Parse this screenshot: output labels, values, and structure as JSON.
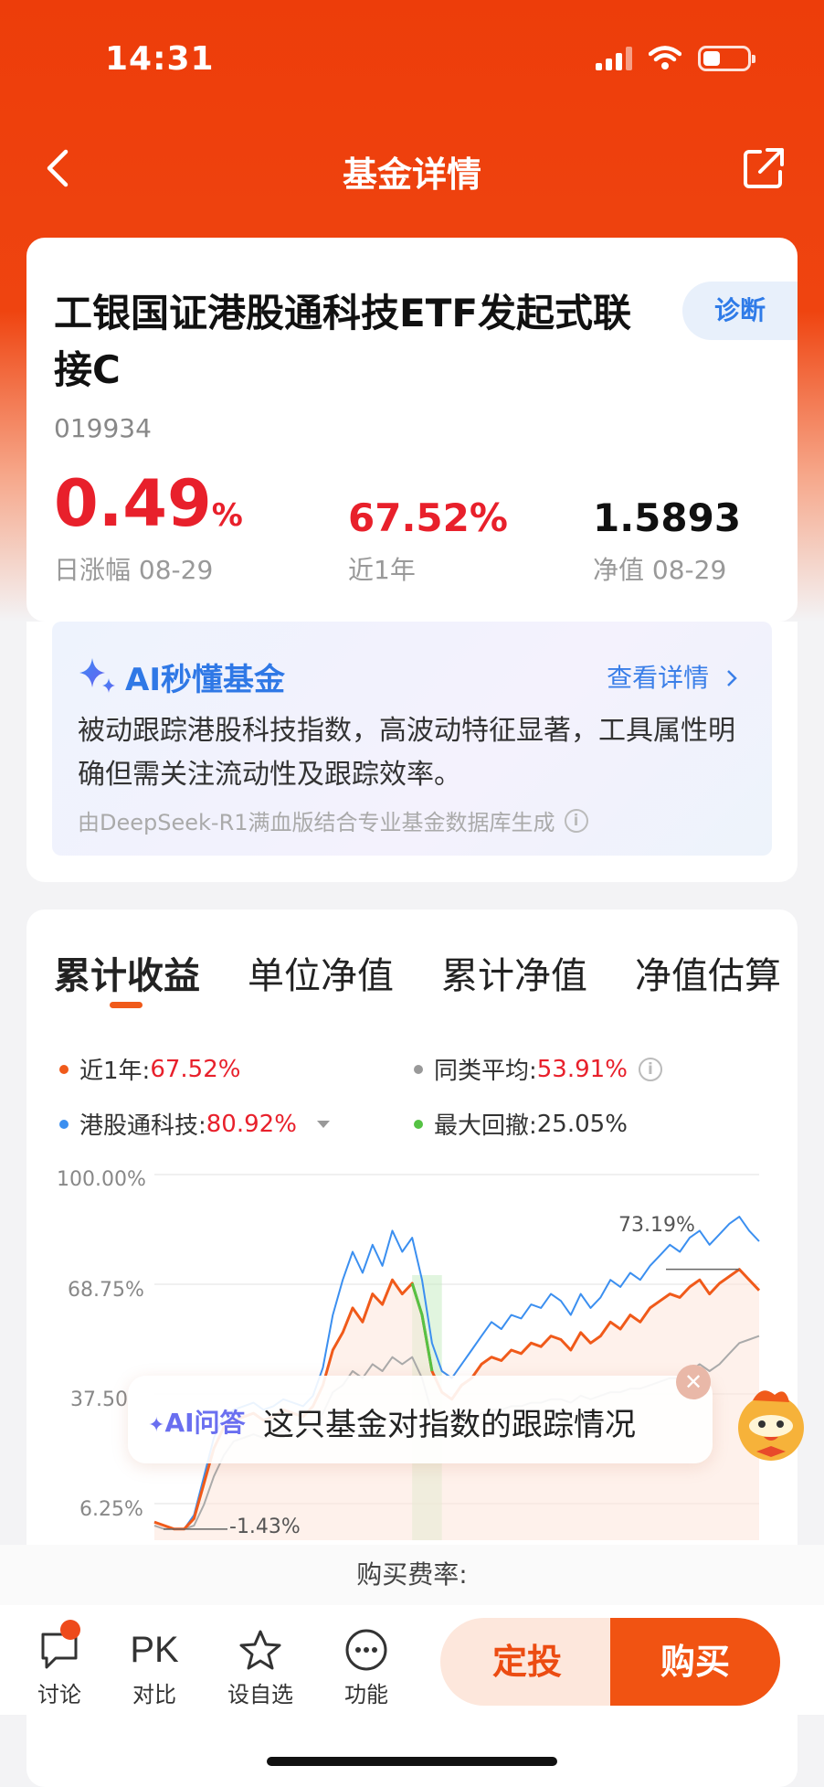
{
  "status_bar": {
    "time": "14:31"
  },
  "nav": {
    "title": "基金详情"
  },
  "fund": {
    "name": "工银国证港股通科技ETF发起式联接C",
    "code": "019934",
    "diagnose_label": "诊断",
    "daily_change_value": "0.49",
    "daily_change_unit": "%",
    "daily_change_label": "日涨幅 08-29",
    "year_return": "67.52%",
    "year_return_label": "近1年",
    "nav_value": "1.5893",
    "nav_label": "净值 08-29"
  },
  "ai_card": {
    "title": "AI秒懂基金",
    "more_label": "查看详情",
    "summary": "被动跟踪港股科技指数，高波动特征显著，工具属性明确但需关注流动性及跟踪效率。",
    "footnote": "由DeepSeek-R1满血版结合专业基金数据库生成"
  },
  "tabs": [
    "累计收益",
    "单位净值",
    "累计净值",
    "净值估算"
  ],
  "legend": {
    "year": {
      "label": "近1年:",
      "value": "67.52%",
      "color": "#f05a1a"
    },
    "peer_avg": {
      "label": "同类平均:",
      "value": "53.91%",
      "color": "#999999"
    },
    "index": {
      "label": "港股通科技:",
      "value": "80.92%",
      "color": "#3b8ff0"
    },
    "max_drawdown": {
      "label": "最大回撤:",
      "value": "25.05%",
      "color": "#55c244"
    }
  },
  "chart_data": {
    "type": "line",
    "y_ticks": [
      "100.00%",
      "68.75%",
      "37.50",
      "6.25%"
    ],
    "ylim": [
      -10,
      100
    ],
    "annotations": [
      "73.19%",
      "-1.43%"
    ],
    "series": [
      {
        "name": "近1年",
        "color": "#f05a1a",
        "values": [
          1,
          0,
          -1,
          -1,
          2,
          12,
          22,
          28,
          30,
          31,
          32,
          30,
          31,
          33,
          32,
          31,
          34,
          40,
          50,
          55,
          62,
          58,
          66,
          63,
          70,
          66,
          69,
          60,
          44,
          38,
          36,
          40,
          42,
          46,
          48,
          47,
          50,
          49,
          52,
          51,
          54,
          53,
          50,
          55,
          52,
          54,
          58,
          56,
          60,
          58,
          62,
          64,
          66,
          65,
          68,
          70,
          66,
          69,
          71,
          73,
          70,
          67
        ]
      },
      {
        "name": "港股通科技",
        "color": "#3b8ff0",
        "values": [
          1,
          0,
          -1,
          -1,
          3,
          14,
          25,
          31,
          33,
          34,
          35,
          33,
          34,
          36,
          35,
          34,
          37,
          45,
          60,
          70,
          78,
          72,
          80,
          74,
          84,
          78,
          82,
          70,
          52,
          44,
          42,
          46,
          50,
          54,
          58,
          56,
          60,
          59,
          63,
          62,
          66,
          64,
          60,
          66,
          62,
          65,
          70,
          68,
          72,
          70,
          74,
          77,
          80,
          78,
          82,
          84,
          80,
          83,
          86,
          88,
          84,
          81
        ]
      },
      {
        "name": "同类平均",
        "color": "#aaaaaa",
        "values": [
          0,
          -1,
          -1,
          -1,
          0,
          6,
          14,
          20,
          24,
          25,
          26,
          25,
          26,
          27,
          26,
          26,
          28,
          32,
          38,
          40,
          44,
          42,
          46,
          44,
          48,
          46,
          48,
          42,
          32,
          28,
          27,
          29,
          30,
          32,
          33,
          33,
          34,
          34,
          35,
          35,
          36,
          36,
          35,
          37,
          36,
          37,
          38,
          38,
          39,
          39,
          40,
          41,
          42,
          42,
          44,
          46,
          44,
          46,
          49,
          52,
          53,
          54
        ]
      }
    ]
  },
  "ask": {
    "prefix": "AI问答",
    "text": "这只基金对指数的跟踪情况"
  },
  "fee": {
    "label": "购买费率:"
  },
  "bottom_bar": {
    "discuss": "讨论",
    "compare_icon": "PK",
    "compare": "对比",
    "watch": "设自选",
    "more": "功能",
    "auto_invest": "定投",
    "buy": "购买"
  }
}
